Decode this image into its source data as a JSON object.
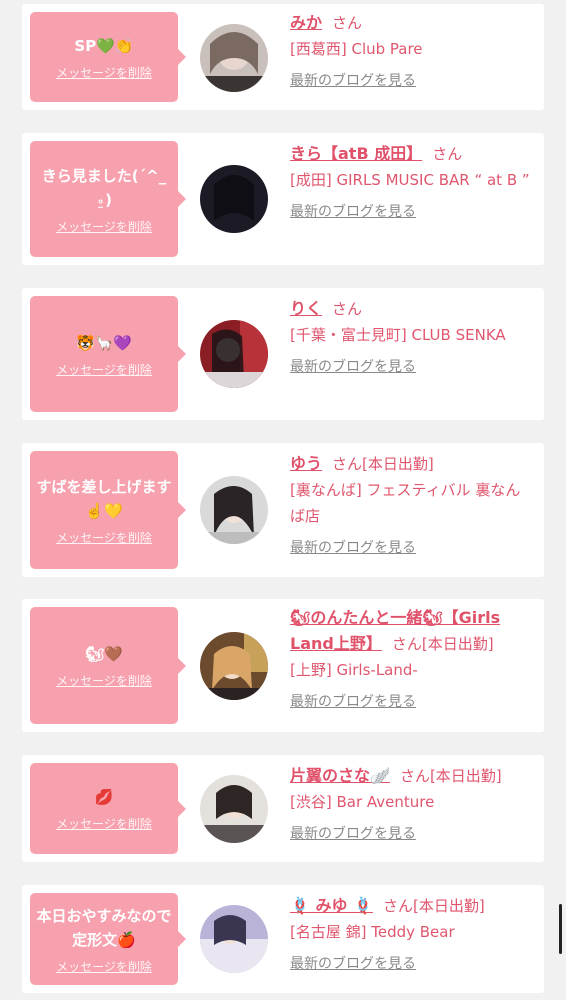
{
  "delete_label": "メッセージを削除",
  "blog_label": "最新のブログを見る",
  "san_label": "さん",
  "colors": {
    "bubble": "#f7a1ae",
    "name": "#e0516a",
    "link_gray": "#8a8a8a",
    "background": "#f1f1f1"
  },
  "entries": [
    {
      "message": "SP💚👏",
      "name": "みか",
      "status": "",
      "shop": "[西葛西] Club Pare"
    },
    {
      "message": "きら見ました(ˊ^_⍛)",
      "name": "きら【atB 成田】",
      "status": "",
      "shop": "[成田] GIRLS MUSIC BAR “ at B ”"
    },
    {
      "message": "🐯🦙💜",
      "name": "りく",
      "status": "",
      "shop": "[千葉・富士見町] CLUB SENKA"
    },
    {
      "message": "すばを差し上げます☝️💛",
      "name": "ゆう",
      "status": "[本日出勤]",
      "shop": "[裏なんば] フェスティバル 裏なんば店"
    },
    {
      "message": "🐿🤎",
      "name": "🐿のんたんと一緒🐿【Girls Land上野】",
      "status": "[本日出勤]",
      "shop": "[上野] Girls-Land-"
    },
    {
      "message": "💋",
      "name": "片翼のさな🪽",
      "status": "[本日出勤]",
      "shop": "[渋谷] Bar Aventure"
    },
    {
      "message": "本日おやすみなので定形文🍎",
      "name": "🪢 みゆ 🪢",
      "status": "[本日出勤]",
      "shop": "[名古屋 錦] Teddy Bear"
    }
  ]
}
